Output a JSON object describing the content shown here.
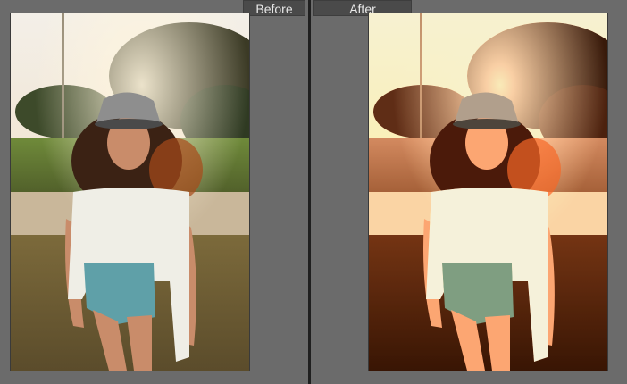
{
  "compare_view": {
    "before_label": "Before",
    "after_label": "After"
  },
  "colors": {
    "workspace_bg": "#6b6b6b",
    "label_bg": "#4a4a4a",
    "label_text": "#e8e8e8",
    "divider": "#1f1f1f"
  }
}
